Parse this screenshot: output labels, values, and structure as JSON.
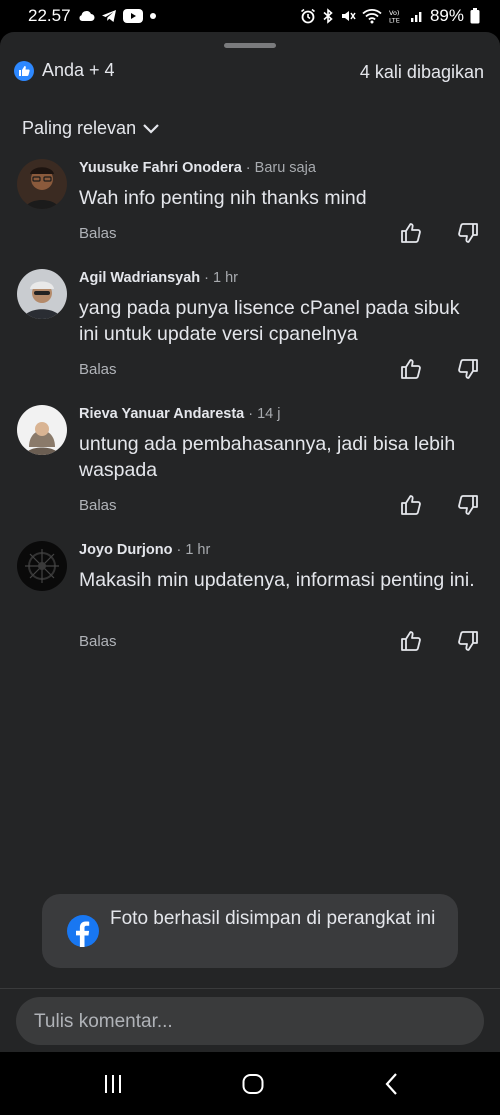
{
  "status_bar": {
    "time": "22.57",
    "battery": "89%",
    "left_icons": [
      "cloud-icon",
      "telegram-icon",
      "youtube-icon",
      "dot-icon"
    ],
    "right_icons": [
      "alarm-icon",
      "bluetooth-icon",
      "mute-icon",
      "wifi-icon",
      "volte-icon",
      "signal-icon",
      "battery-icon"
    ]
  },
  "header": {
    "reactions": "Anda + 4",
    "shares": "4 kali dibagikan",
    "sort_label": "Paling relevan"
  },
  "comments": [
    {
      "author": "Yuusuke Fahri Onodera",
      "time": " · Baru saja",
      "text": "Wah info penting nih thanks mind",
      "reply": "Balas"
    },
    {
      "author": "Agil Wadriansyah",
      "time": " · 1 hr",
      "text": "yang pada punya lisence cPanel pada sibuk ini untuk update versi cpanelnya",
      "reply": "Balas"
    },
    {
      "author": "Rieva Yanuar Andaresta",
      "time": " · 14 j",
      "text": "untung ada pembahasannya, jadi bisa lebih waspada",
      "reply": "Balas"
    },
    {
      "author": "Joyo Durjono",
      "time": " · 1 hr",
      "text": "Makasih min updatenya, informasi penting ini.",
      "reply": "Balas"
    }
  ],
  "toast": {
    "text": "Foto berhasil disimpan di perangkat ini"
  },
  "composer": {
    "placeholder": "Tulis komentar..."
  },
  "colors": {
    "sheet_bg": "#242526",
    "accent": "#1877f2",
    "muted_text": "#b0b3b8"
  }
}
